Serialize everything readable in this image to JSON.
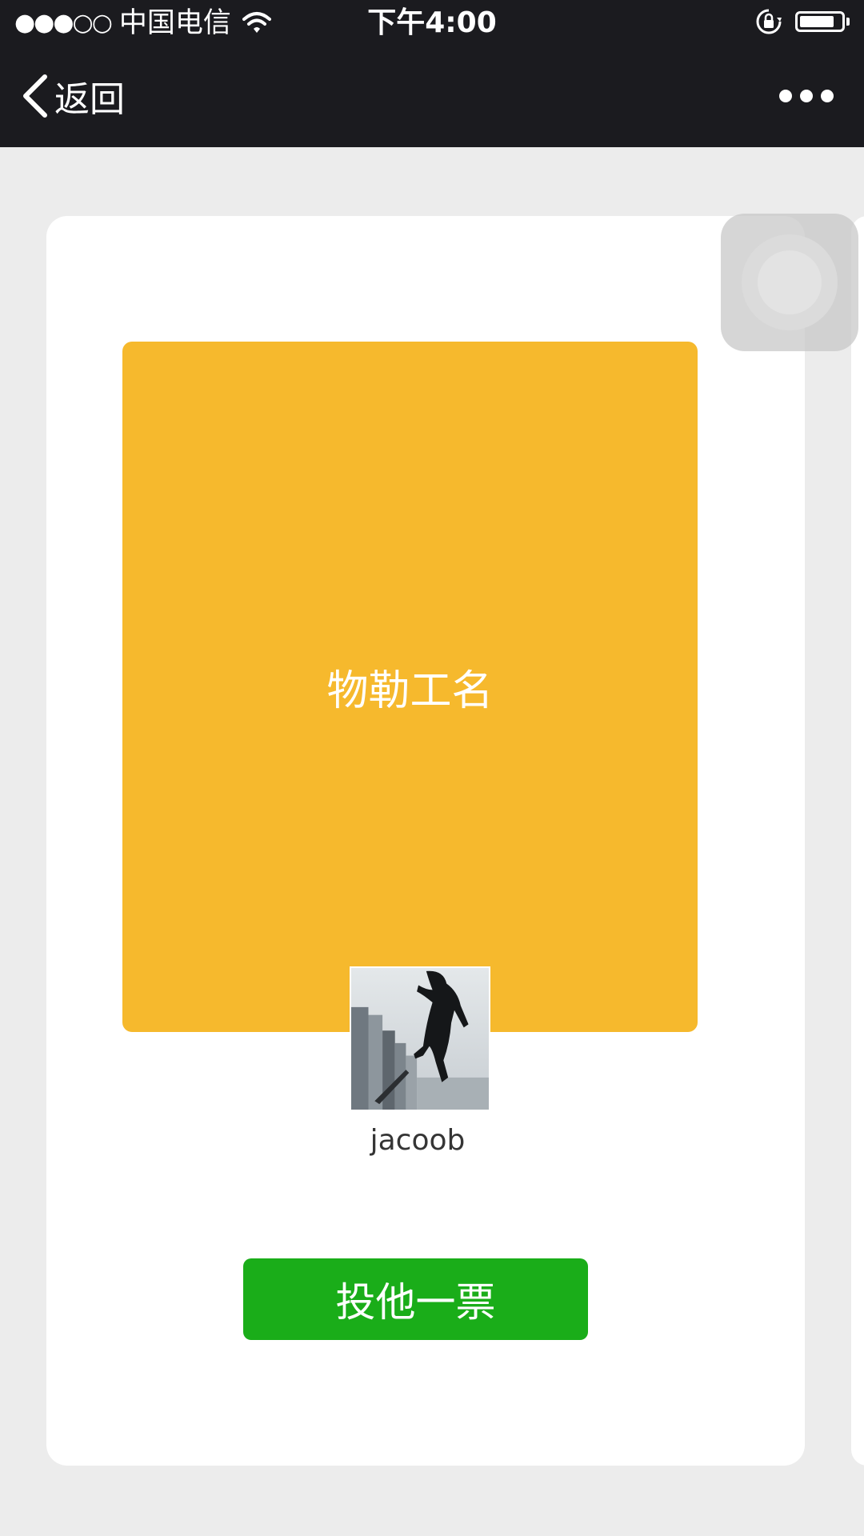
{
  "status_bar": {
    "signal": "●●●○○",
    "carrier": "中国电信",
    "time": "下午4:00",
    "battery_level": 0.85,
    "icons": [
      "wifi-icon",
      "lock-rotation-icon",
      "battery-icon"
    ]
  },
  "nav": {
    "back_label": "返回",
    "back_icon": "chevron-left-icon",
    "more_icon": "more-dots-icon"
  },
  "card": {
    "poster_title": "物勒工名",
    "poster_color": "#f6b92d",
    "username": "jacoob",
    "vote_label": "投他一票",
    "vote_color": "#1aad19"
  },
  "floating_button": {
    "icon": "assistive-touch-icon"
  }
}
